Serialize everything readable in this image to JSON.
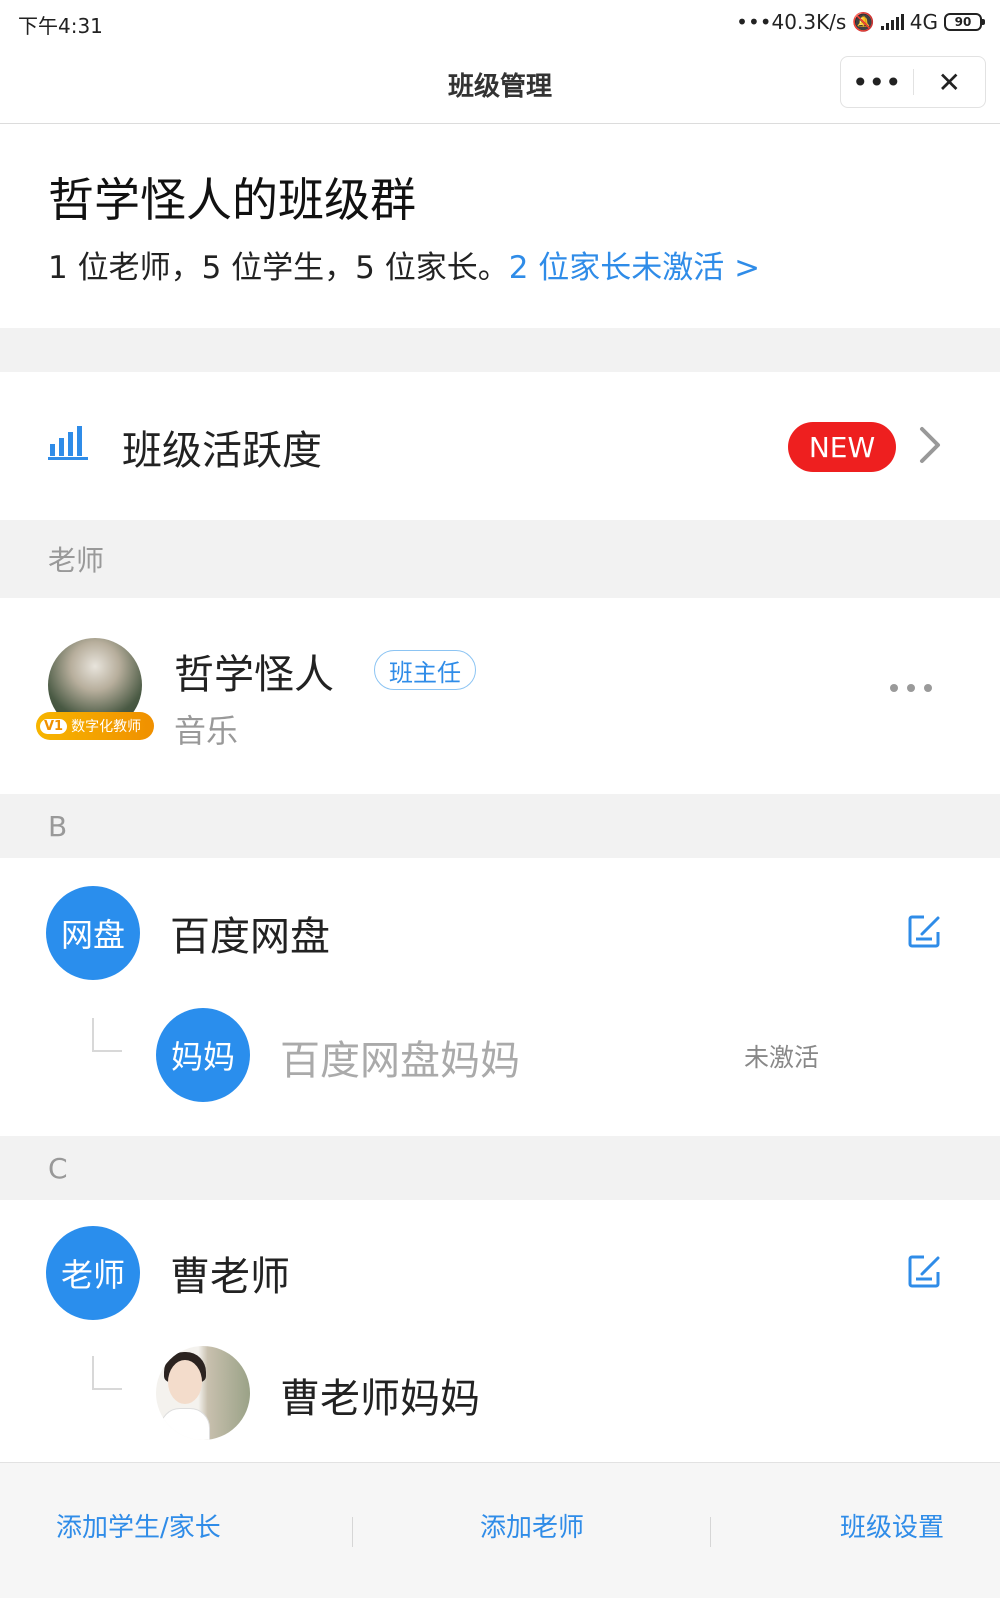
{
  "status_bar": {
    "time": "下午4:31",
    "network_speed": "•••40.3K/s",
    "network_type": "4G",
    "battery": "90"
  },
  "nav": {
    "title": "班级管理",
    "more_label": "•••",
    "close_label": "✕"
  },
  "header": {
    "class_name": "哲学怪人的班级群",
    "summary": "1 位老师，5 位学生，5 位家长。",
    "inactive_link": "2 位家长未激活 >"
  },
  "activity": {
    "label": "班级活跃度",
    "badge": "NEW"
  },
  "sections": {
    "teachers": "老师",
    "b": "B",
    "c": "C"
  },
  "teacher": {
    "name": "哲学怪人",
    "role_tag": "班主任",
    "subject": "音乐",
    "badge_v": "V1",
    "badge_text": "数字化教师"
  },
  "students": [
    {
      "avatar_text": "网盘",
      "name": "百度网盘",
      "parent": {
        "avatar_text": "妈妈",
        "name": "百度网盘妈妈",
        "status": "未激活"
      }
    },
    {
      "avatar_text": "老师",
      "name": "曹老师",
      "parent": {
        "name": "曹老师妈妈"
      }
    }
  ],
  "bottom": {
    "add_student": "添加学生/家长",
    "add_teacher": "添加老师",
    "class_settings": "班级设置"
  },
  "colors": {
    "accent": "#2f8ce8",
    "avatar_blue": "#2a8eed",
    "new_badge": "#ee1f1f",
    "section_bg": "#f2f2f2"
  }
}
